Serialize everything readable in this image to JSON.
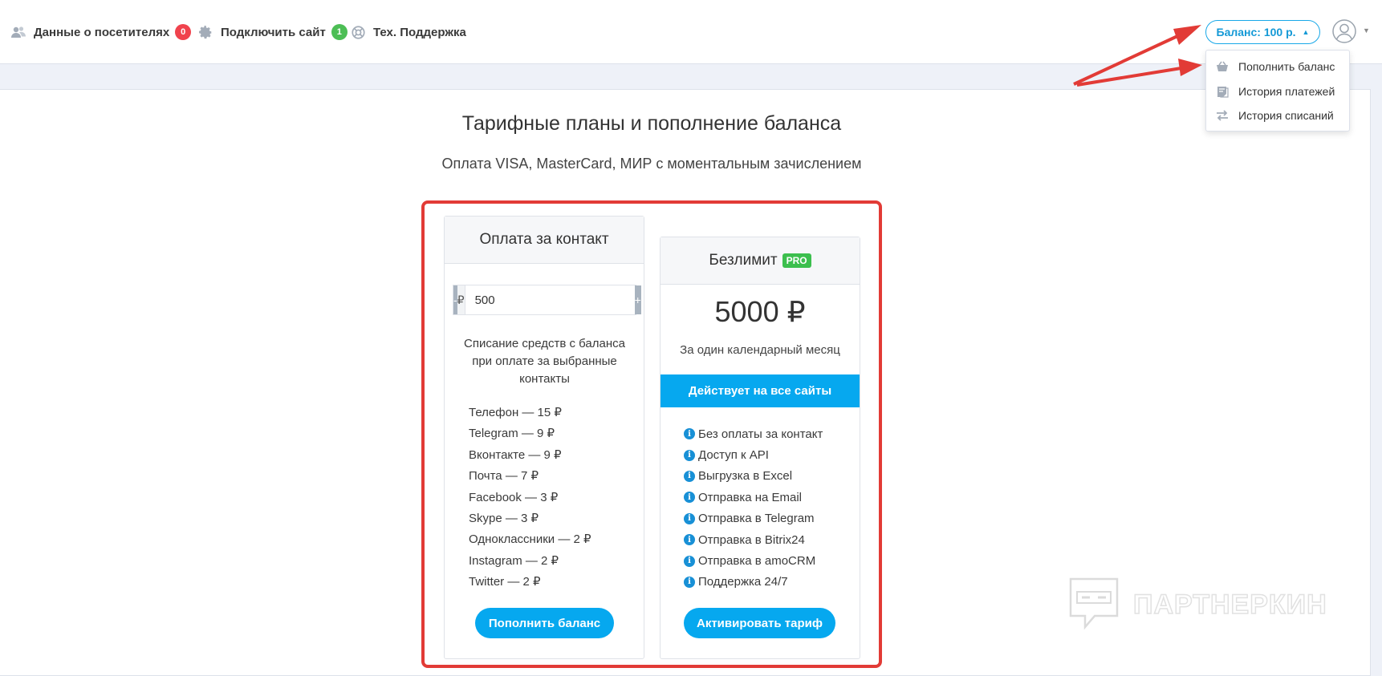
{
  "nav": {
    "visitors": {
      "label": "Данные о посетителях",
      "count": "0"
    },
    "connect": {
      "label": "Подключить сайт",
      "count": "1"
    },
    "support": {
      "label": "Тех. Поддержка"
    }
  },
  "balance": {
    "label": "Баланс: 100 р."
  },
  "dropdown": {
    "items": [
      {
        "label": "Пополнить баланс",
        "icon": "basket-icon"
      },
      {
        "label": "История платежей",
        "icon": "receipt-icon"
      },
      {
        "label": "История списаний",
        "icon": "transfer-icon"
      }
    ]
  },
  "page": {
    "title": "Тарифные планы и пополнение баланса",
    "subtitle": "Оплата VISA, MasterCard, МИР с моментальным зачислением"
  },
  "plan_contact": {
    "title": "Оплата за контакт",
    "minus": "-",
    "currency": "₽",
    "amount": "500",
    "plus": "+",
    "description": "Списание средств с баланса при оплате за выбранные контакты",
    "prices": [
      "Телефон — 15 ₽",
      "Telegram — 9 ₽",
      "Вконтакте — 9 ₽",
      "Почта — 7 ₽",
      "Facebook — 3 ₽",
      "Skype — 3 ₽",
      "Одноклассники — 2 ₽",
      "Instagram — 2 ₽",
      "Twitter — 2 ₽"
    ],
    "button": "Пополнить баланс"
  },
  "plan_unlimited": {
    "title": "Безлимит",
    "badge": "PRO",
    "price": "5000 ₽",
    "period": "За один календарный месяц",
    "banner": "Действует на все сайты",
    "features": [
      "Без оплаты за контакт",
      "Доступ к API",
      "Выгрузка в Excel",
      "Отправка на Email",
      "Отправка в Telegram",
      "Отправка в Bitrix24",
      "Отправка в amoCRM",
      "Поддержка 24/7"
    ],
    "button": "Активировать тариф"
  },
  "watermark": "ПАРТНЕРКИН",
  "colors": {
    "accent": "#06a8ef",
    "highlight": "#e23b36",
    "badge_red": "#f0434d",
    "badge_green": "#4cbe55"
  }
}
